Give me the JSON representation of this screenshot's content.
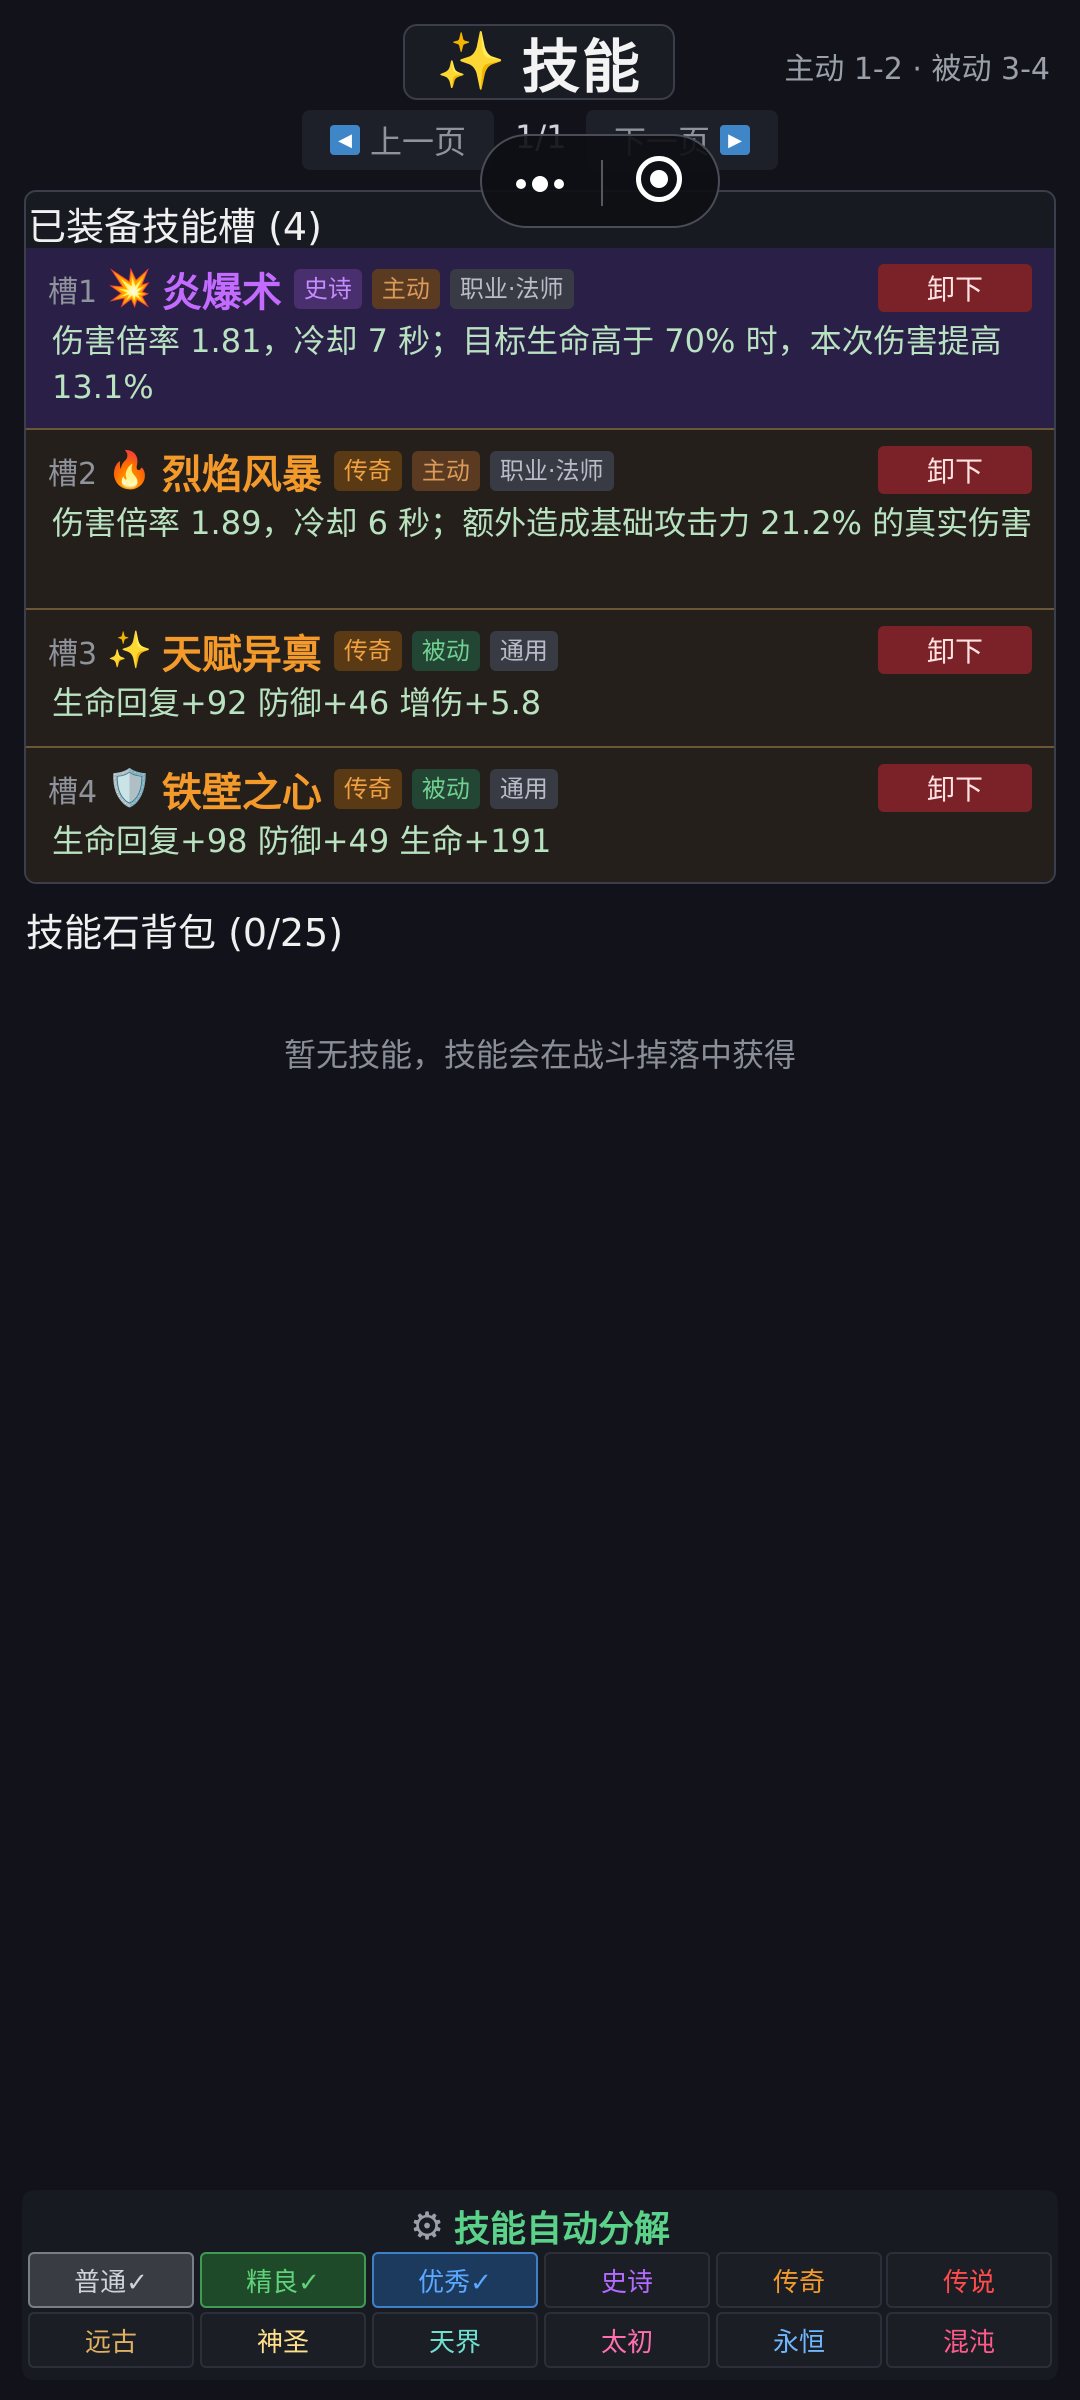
{
  "header": {
    "title_icon": "✨",
    "title": "技能",
    "hint": "主动 1-2 · 被动 3-4"
  },
  "pager": {
    "prev_label": "上一页",
    "next_label": "下一页",
    "page": "1/1"
  },
  "equipped": {
    "title": "已装备技能槽 (4)",
    "unequip_label": "卸下",
    "slots": [
      {
        "no": "槽1",
        "icon": "💥",
        "name": "炎爆术",
        "name_color": "#c36bff",
        "rarity": "史诗",
        "kind": "主动",
        "scope": "职业·法师",
        "desc": "伤害倍率 1.81，冷却 7 秒；目标生命高于 70% 时，本次伤害提高 13.1%"
      },
      {
        "no": "槽2",
        "icon": "🔥",
        "name": "烈焰风暴",
        "name_color": "#f39a2a",
        "rarity": "传奇",
        "kind": "主动",
        "scope": "职业·法师",
        "desc": "伤害倍率 1.89，冷却 6 秒；额外造成基础攻击力 21.2% 的真实伤害"
      },
      {
        "no": "槽3",
        "icon": "✨",
        "name": "天赋异禀",
        "name_color": "#f39a2a",
        "rarity": "传奇",
        "kind": "被动",
        "scope": "通用",
        "desc": "生命回复+92 防御+46 增伤+5.8"
      },
      {
        "no": "槽4",
        "icon": "🛡️",
        "name": "铁壁之心",
        "name_color": "#f39a2a",
        "rarity": "传奇",
        "kind": "被动",
        "scope": "通用",
        "desc": "生命回复+98 防御+49 生命+191"
      }
    ]
  },
  "backpack": {
    "title": "技能石背包 (0/25)",
    "empty": "暂无技能，技能会在战斗掉落中获得"
  },
  "auto_decompose": {
    "title": "技能自动分解",
    "grades": [
      {
        "label": "普通✓",
        "color": "#cfd2d8",
        "checked": true
      },
      {
        "label": "精良✓",
        "color": "#5fd27a",
        "checked": true
      },
      {
        "label": "优秀✓",
        "color": "#5aa8ff",
        "checked": true
      },
      {
        "label": "史诗",
        "color": "#b36bff",
        "checked": false
      },
      {
        "label": "传奇",
        "color": "#f39a2a",
        "checked": false
      },
      {
        "label": "传说",
        "color": "#ff4b4b",
        "checked": false
      },
      {
        "label": "远古",
        "color": "#e0b060",
        "checked": false
      },
      {
        "label": "神圣",
        "color": "#ffe08a",
        "checked": false
      },
      {
        "label": "天界",
        "color": "#6fe0d0",
        "checked": false
      },
      {
        "label": "太初",
        "color": "#ff6fb0",
        "checked": false
      },
      {
        "label": "永恒",
        "color": "#6fb8ff",
        "checked": false
      },
      {
        "label": "混沌",
        "color": "#ff5a8a",
        "checked": false
      }
    ]
  }
}
